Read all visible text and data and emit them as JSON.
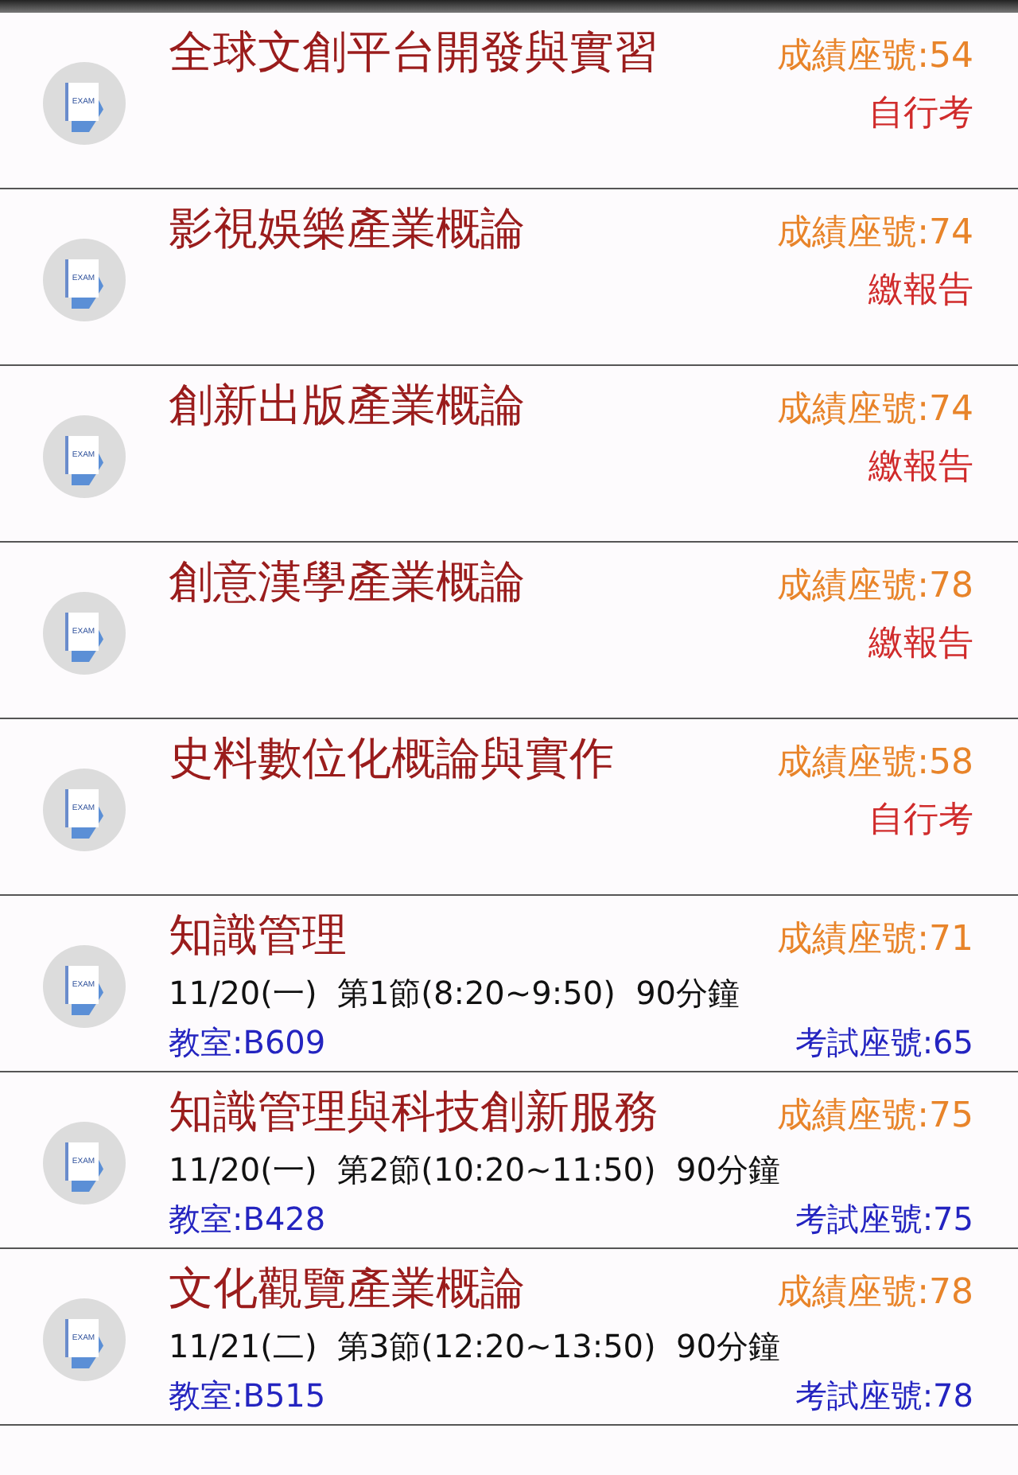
{
  "exams": [
    {
      "kind": "self",
      "icon_label": "EXAM",
      "title": "全球文創平台開發與實習",
      "grade_seat": "成績座號:54",
      "note": "自行考"
    },
    {
      "kind": "self",
      "icon_label": "EXAM",
      "title": "影視娛樂產業概論",
      "grade_seat": "成績座號:74",
      "note": "繳報告"
    },
    {
      "kind": "self",
      "icon_label": "EXAM",
      "title": "創新出版產業概論",
      "grade_seat": "成績座號:74",
      "note": "繳報告"
    },
    {
      "kind": "self",
      "icon_label": "EXAM",
      "title": "創意漢學產業概論",
      "grade_seat": "成績座號:78",
      "note": "繳報告"
    },
    {
      "kind": "self",
      "icon_label": "EXAM",
      "title": "史料數位化概論與實作",
      "grade_seat": "成績座號:58",
      "note": "自行考"
    },
    {
      "kind": "scheduled",
      "icon_label": "EXAM",
      "title": "知識管理",
      "grade_seat": "成績座號:71",
      "time": "11/20(一)  第1節(8:20~9:50)  90分鐘",
      "room": "教室:B609",
      "exam_seat": "考試座號:65"
    },
    {
      "kind": "scheduled",
      "icon_label": "EXAM",
      "title": "知識管理與科技創新服務",
      "grade_seat": "成績座號:75",
      "time": "11/20(一)  第2節(10:20~11:50)  90分鐘",
      "room": "教室:B428",
      "exam_seat": "考試座號:75"
    },
    {
      "kind": "scheduled",
      "icon_label": "EXAM",
      "title": "文化觀覽產業概論",
      "grade_seat": "成績座號:78",
      "time": "11/21(二)  第3節(12:20~13:50)  90分鐘",
      "room": "教室:B515",
      "exam_seat": "考試座號:78"
    }
  ]
}
